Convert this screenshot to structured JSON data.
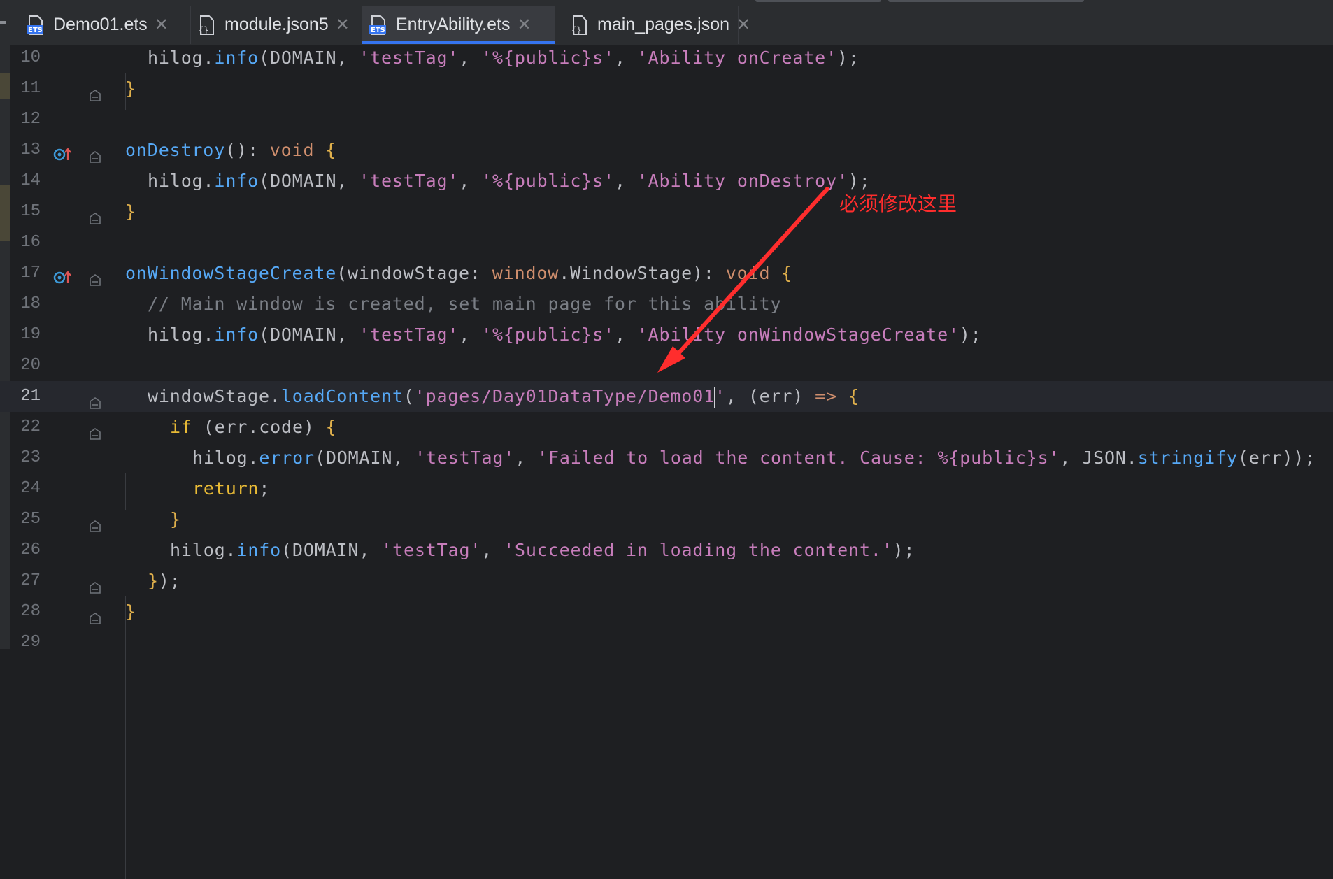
{
  "tabs": [
    {
      "label": "Demo01.ets",
      "icon": "ets-file-icon",
      "active": false
    },
    {
      "label": "module.json5",
      "icon": "json-config-file-icon",
      "active": false
    },
    {
      "label": "EntryAbility.ets",
      "icon": "ets-file-icon",
      "active": true
    },
    {
      "label": "main_pages.json",
      "icon": "json-config-file-icon",
      "active": false
    }
  ],
  "tab_close_glyph": "✕",
  "editor": {
    "current_line": "21",
    "lines": [
      {
        "num": "10",
        "tokens": [
          [
            "hilog",
            "id"
          ],
          [
            ".",
            "p"
          ],
          [
            "info",
            "fn"
          ],
          [
            "(",
            "p"
          ],
          [
            "DOMAIN",
            "id"
          ],
          [
            ", ",
            "p"
          ],
          [
            "'testTag'",
            "str"
          ],
          [
            ", ",
            "p"
          ],
          [
            "'%{public}s'",
            "str"
          ],
          [
            ", ",
            "p"
          ],
          [
            "'Ability onCreate'",
            "str"
          ],
          [
            ");",
            "p"
          ]
        ]
      },
      {
        "num": "11",
        "tokens": [
          [
            "}",
            "br"
          ]
        ]
      },
      {
        "num": "12",
        "tokens": []
      },
      {
        "num": "13",
        "tokens": [
          [
            "onDestroy",
            "fn"
          ],
          [
            "()",
            "p"
          ],
          [
            ": ",
            "p"
          ],
          [
            "void",
            "kw"
          ],
          [
            " ",
            "p"
          ],
          [
            "{",
            "br"
          ]
        ]
      },
      {
        "num": "14",
        "tokens": [
          [
            "hilog",
            "id"
          ],
          [
            ".",
            "p"
          ],
          [
            "info",
            "fn"
          ],
          [
            "(",
            "p"
          ],
          [
            "DOMAIN",
            "id"
          ],
          [
            ", ",
            "p"
          ],
          [
            "'testTag'",
            "str"
          ],
          [
            ", ",
            "p"
          ],
          [
            "'%{public}s'",
            "str"
          ],
          [
            ", ",
            "p"
          ],
          [
            "'Ability onDestroy'",
            "str"
          ],
          [
            ");",
            "p"
          ]
        ]
      },
      {
        "num": "15",
        "tokens": [
          [
            "}",
            "br"
          ]
        ]
      },
      {
        "num": "16",
        "tokens": []
      },
      {
        "num": "17",
        "tokens": [
          [
            "onWindowStageCreate",
            "fn"
          ],
          [
            "(",
            "p"
          ],
          [
            "windowStage",
            "id"
          ],
          [
            ": ",
            "p"
          ],
          [
            "window",
            "kw"
          ],
          [
            ".",
            "p"
          ],
          [
            "WindowStage",
            "id"
          ],
          [
            ")",
            "p"
          ],
          [
            ": ",
            "p"
          ],
          [
            "void",
            "kw"
          ],
          [
            " ",
            "p"
          ],
          [
            "{",
            "br"
          ]
        ]
      },
      {
        "num": "18",
        "tokens": [
          [
            "// Main window is created, set main page for this ability",
            "cm"
          ]
        ]
      },
      {
        "num": "19",
        "tokens": [
          [
            "hilog",
            "id"
          ],
          [
            ".",
            "p"
          ],
          [
            "info",
            "fn"
          ],
          [
            "(",
            "p"
          ],
          [
            "DOMAIN",
            "id"
          ],
          [
            ", ",
            "p"
          ],
          [
            "'testTag'",
            "str"
          ],
          [
            ", ",
            "p"
          ],
          [
            "'%{public}s'",
            "str"
          ],
          [
            ", ",
            "p"
          ],
          [
            "'Ability onWindowStageCreate'",
            "str"
          ],
          [
            ");",
            "p"
          ]
        ]
      },
      {
        "num": "20",
        "tokens": []
      },
      {
        "num": "21",
        "tokens": [
          [
            "windowStage",
            "id"
          ],
          [
            ".",
            "p"
          ],
          [
            "loadContent",
            "fn"
          ],
          [
            "(",
            "p"
          ],
          [
            "'pages/Day01DataType/Demo01",
            "str"
          ],
          [
            "|caret|",
            "caret"
          ],
          [
            "'",
            "str"
          ],
          [
            ", ",
            "p"
          ],
          [
            "(",
            "p"
          ],
          [
            "err",
            "id"
          ],
          [
            ") ",
            "p"
          ],
          [
            "=>",
            "kw"
          ],
          [
            " ",
            "p"
          ],
          [
            "{",
            "br"
          ]
        ]
      },
      {
        "num": "22",
        "tokens": [
          [
            "if",
            "ret"
          ],
          [
            " (",
            "p"
          ],
          [
            "err",
            "id"
          ],
          [
            ".",
            "p"
          ],
          [
            "code",
            "id"
          ],
          [
            ") ",
            "p"
          ],
          [
            "{",
            "br"
          ]
        ]
      },
      {
        "num": "23",
        "tokens": [
          [
            "hilog",
            "id"
          ],
          [
            ".",
            "p"
          ],
          [
            "error",
            "fn"
          ],
          [
            "(",
            "p"
          ],
          [
            "DOMAIN",
            "id"
          ],
          [
            ", ",
            "p"
          ],
          [
            "'testTag'",
            "str"
          ],
          [
            ", ",
            "p"
          ],
          [
            "'Failed to load the content. Cause: %{public}s'",
            "str"
          ],
          [
            ", ",
            "p"
          ],
          [
            "JSON",
            "id"
          ],
          [
            ".",
            "p"
          ],
          [
            "stringify",
            "fn"
          ],
          [
            "(",
            "p"
          ],
          [
            "err",
            "id"
          ],
          [
            "));",
            "p"
          ]
        ]
      },
      {
        "num": "24",
        "tokens": [
          [
            "return",
            "ret"
          ],
          [
            ";",
            "p"
          ]
        ]
      },
      {
        "num": "25",
        "tokens": [
          [
            "}",
            "br"
          ]
        ]
      },
      {
        "num": "26",
        "tokens": [
          [
            "hilog",
            "id"
          ],
          [
            ".",
            "p"
          ],
          [
            "info",
            "fn"
          ],
          [
            "(",
            "p"
          ],
          [
            "DOMAIN",
            "id"
          ],
          [
            ", ",
            "p"
          ],
          [
            "'testTag'",
            "str"
          ],
          [
            ", ",
            "p"
          ],
          [
            "'Succeeded in loading the content.'",
            "str"
          ],
          [
            ");",
            "p"
          ]
        ]
      },
      {
        "num": "27",
        "tokens": [
          [
            "}",
            "br"
          ],
          [
            ");",
            "p"
          ]
        ]
      },
      {
        "num": "28",
        "tokens": [
          [
            "}",
            "br"
          ]
        ]
      },
      {
        "num": "29",
        "tokens": []
      }
    ]
  },
  "annotation": {
    "text": "必须修改这里",
    "color": "#ff2d2d"
  },
  "colors": {
    "background": "#1e1f22",
    "accent": "#3574f0",
    "string": "#c77dbb",
    "function": "#56a8f5",
    "keyword": "#cf8e6d"
  }
}
